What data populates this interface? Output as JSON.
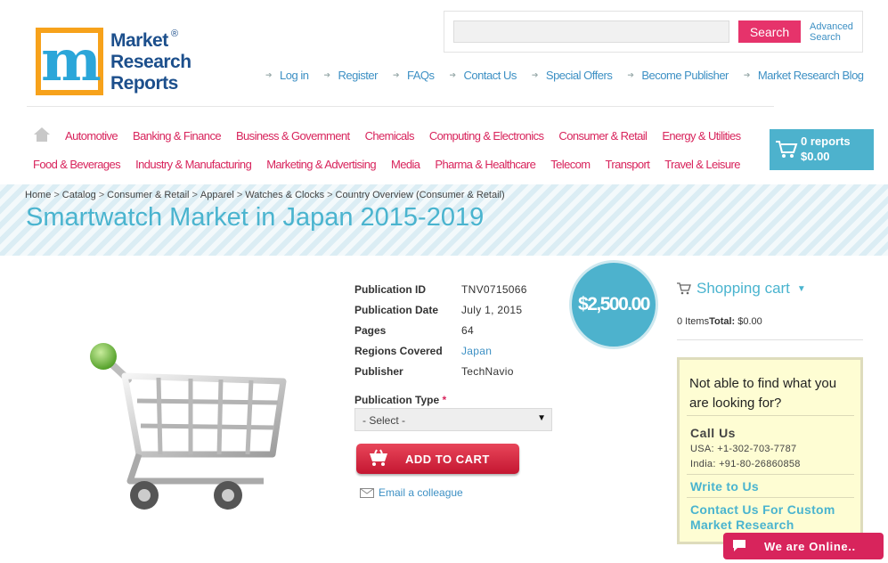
{
  "header": {
    "logo": {
      "line1": "Market",
      "line2": "Research",
      "line3": "Reports",
      "reg": "®"
    },
    "search": {
      "placeholder": "",
      "button": "Search",
      "advanced_line1": "Advanced",
      "advanced_line2": "Search"
    },
    "top_links": [
      "Log in",
      "Register",
      "FAQs",
      "Contact Us",
      "Special Offers",
      "Become Publisher",
      "Market Research Blog"
    ]
  },
  "categories": {
    "row1": [
      "Automotive",
      "Banking & Finance",
      "Business & Government",
      "Chemicals",
      "Computing & Electronics",
      "Consumer & Retail",
      "Energy & Utilities"
    ],
    "row2": [
      "Food & Beverages",
      "Industry & Manufacturing",
      "Marketing & Advertising",
      "Media",
      "Pharma & Healthcare",
      "Telecom",
      "Transport",
      "Travel & Leisure"
    ]
  },
  "cart_summary": {
    "reports": "0 reports",
    "total": "$0.00"
  },
  "breadcrumb": [
    "Home",
    "Catalog",
    "Consumer & Retail",
    "Apparel",
    "Watches & Clocks",
    "Country Overview (Consumer & Retail)"
  ],
  "page_title": "Smartwatch Market in Japan 2015-2019",
  "product": {
    "details": [
      {
        "label": "Publication ID",
        "value": "TNV0715066"
      },
      {
        "label": "Publication Date",
        "value": "July 1, 2015"
      },
      {
        "label": "Pages",
        "value": "64"
      },
      {
        "label": "Regions Covered",
        "value": "Japan"
      },
      {
        "label": "Publisher",
        "value": "TechNavio"
      }
    ],
    "price": "$2,500.00",
    "publication_type_label": "Publication Type",
    "required_mark": "*",
    "publication_type_selected": "- Select -",
    "add_to_cart": "ADD TO CART",
    "email_colleague": "Email a colleague"
  },
  "sidebar": {
    "cart_title": "Shopping cart",
    "items_text": "0 Items",
    "total_label": "Total:",
    "total_value": "$0.00",
    "help": {
      "title": "Not able to find what you are looking for?",
      "call_us": "Call Us",
      "usa_phone": "USA: +1-302-703-7787",
      "india_phone": "India: +91-80-26860858",
      "write_to_us": "Write to Us",
      "custom_line1": "Contact Us For Custom",
      "custom_line2": "Market Research"
    }
  },
  "chat": {
    "label": "We are Online.."
  },
  "colors": {
    "accent_pink": "#d8245c",
    "accent_teal": "#4ab4cf",
    "link_blue": "#3d90c4"
  }
}
